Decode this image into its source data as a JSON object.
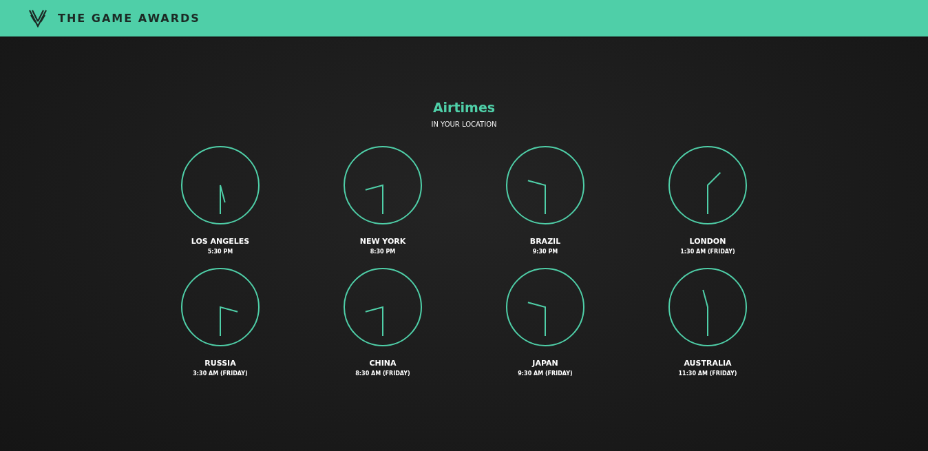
{
  "header": {
    "brand": "THE GAME AWARDS"
  },
  "section": {
    "title": "Airtimes",
    "subtitle": "IN YOUR LOCATION"
  },
  "clocks": [
    {
      "city": "LOS ANGELES",
      "time": "5:30 PM"
    },
    {
      "city": "NEW YORK",
      "time": "8:30 PM"
    },
    {
      "city": "BRAZIL",
      "time": "9:30 PM"
    },
    {
      "city": "LONDON",
      "time": "1:30 AM (FRIDAY)"
    },
    {
      "city": "RUSSIA",
      "time": "3:30 AM (FRIDAY)"
    },
    {
      "city": "CHINA",
      "time": "8:30 AM (FRIDAY)"
    },
    {
      "city": "JAPAN",
      "time": "9:30 AM (FRIDAY)"
    },
    {
      "city": "AUSTRALIA",
      "time": "11:30 AM (FRIDAY)"
    }
  ]
}
